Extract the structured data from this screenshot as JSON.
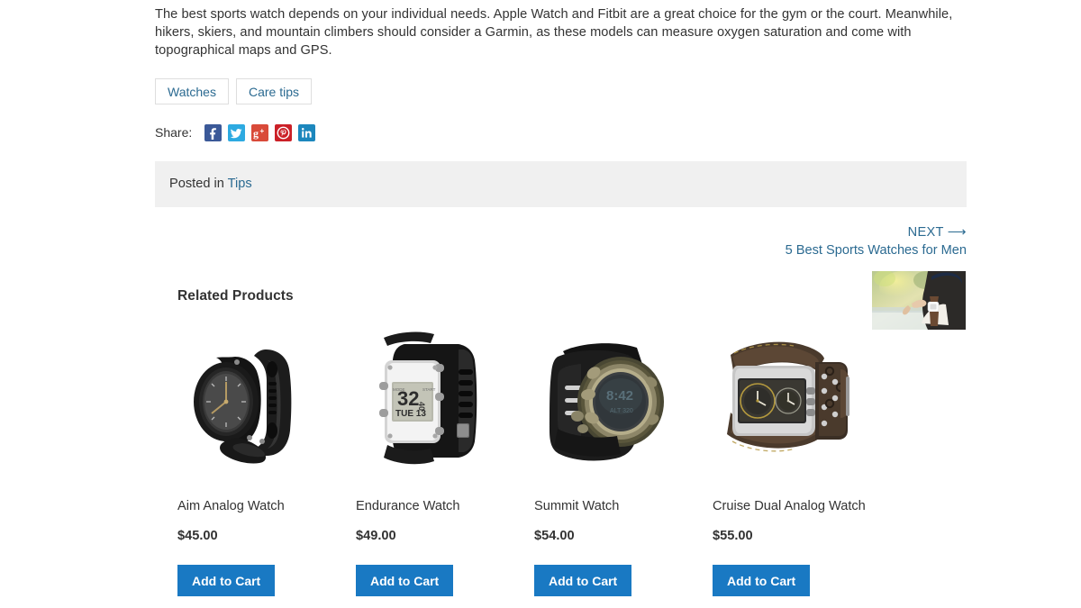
{
  "article": {
    "paragraph": "The best sports watch depends on your individual needs. Apple Watch and Fitbit are a great choice for the gym or the court. Meanwhile, hikers, skiers, and mountain climbers should consider a Garmin, as these models can measure oxygen saturation and come with topographical maps and GPS."
  },
  "tags": [
    {
      "label": "Watches"
    },
    {
      "label": "Care tips"
    }
  ],
  "share": {
    "label": "Share:",
    "icons": [
      {
        "name": "facebook-icon",
        "glyph": "f",
        "color": "#3b5998"
      },
      {
        "name": "twitter-icon",
        "glyph": "",
        "color": "#2daae1"
      },
      {
        "name": "google-plus-icon",
        "glyph": "g+",
        "color": "#d94a39"
      },
      {
        "name": "pinterest-icon",
        "glyph": "",
        "color": "#cb2027"
      },
      {
        "name": "linkedin-icon",
        "glyph": "in",
        "color": "#1c87bd"
      }
    ]
  },
  "posted": {
    "prefix": "Posted in ",
    "category": "Tips"
  },
  "post_nav": {
    "next_label": "NEXT ⟶",
    "next_title": "5 Best Sports Watches for Men",
    "thumbnail_alt": "man checking fitness watch on wrist outdoors"
  },
  "related": {
    "heading": "Related Products",
    "cart_label": "Add to Cart",
    "products": [
      {
        "name": "Aim Analog Watch",
        "price": "$45.00",
        "image_alt": "black analog sports watch with rubber strap"
      },
      {
        "name": "Endurance Watch",
        "price": "$49.00",
        "image_alt": "white digital watch displaying 32 TUE 13"
      },
      {
        "name": "Summit Watch",
        "price": "$54.00",
        "image_alt": "round digital watch with bronze bezel"
      },
      {
        "name": "Cruise Dual Analog Watch",
        "price": "$55.00",
        "image_alt": "dual dial rectangular watch with brown leather strap"
      }
    ]
  },
  "colors": {
    "link": "#2b6a91",
    "button": "#1979c3",
    "bar_background": "#f0f0f0",
    "text": "#333333"
  }
}
